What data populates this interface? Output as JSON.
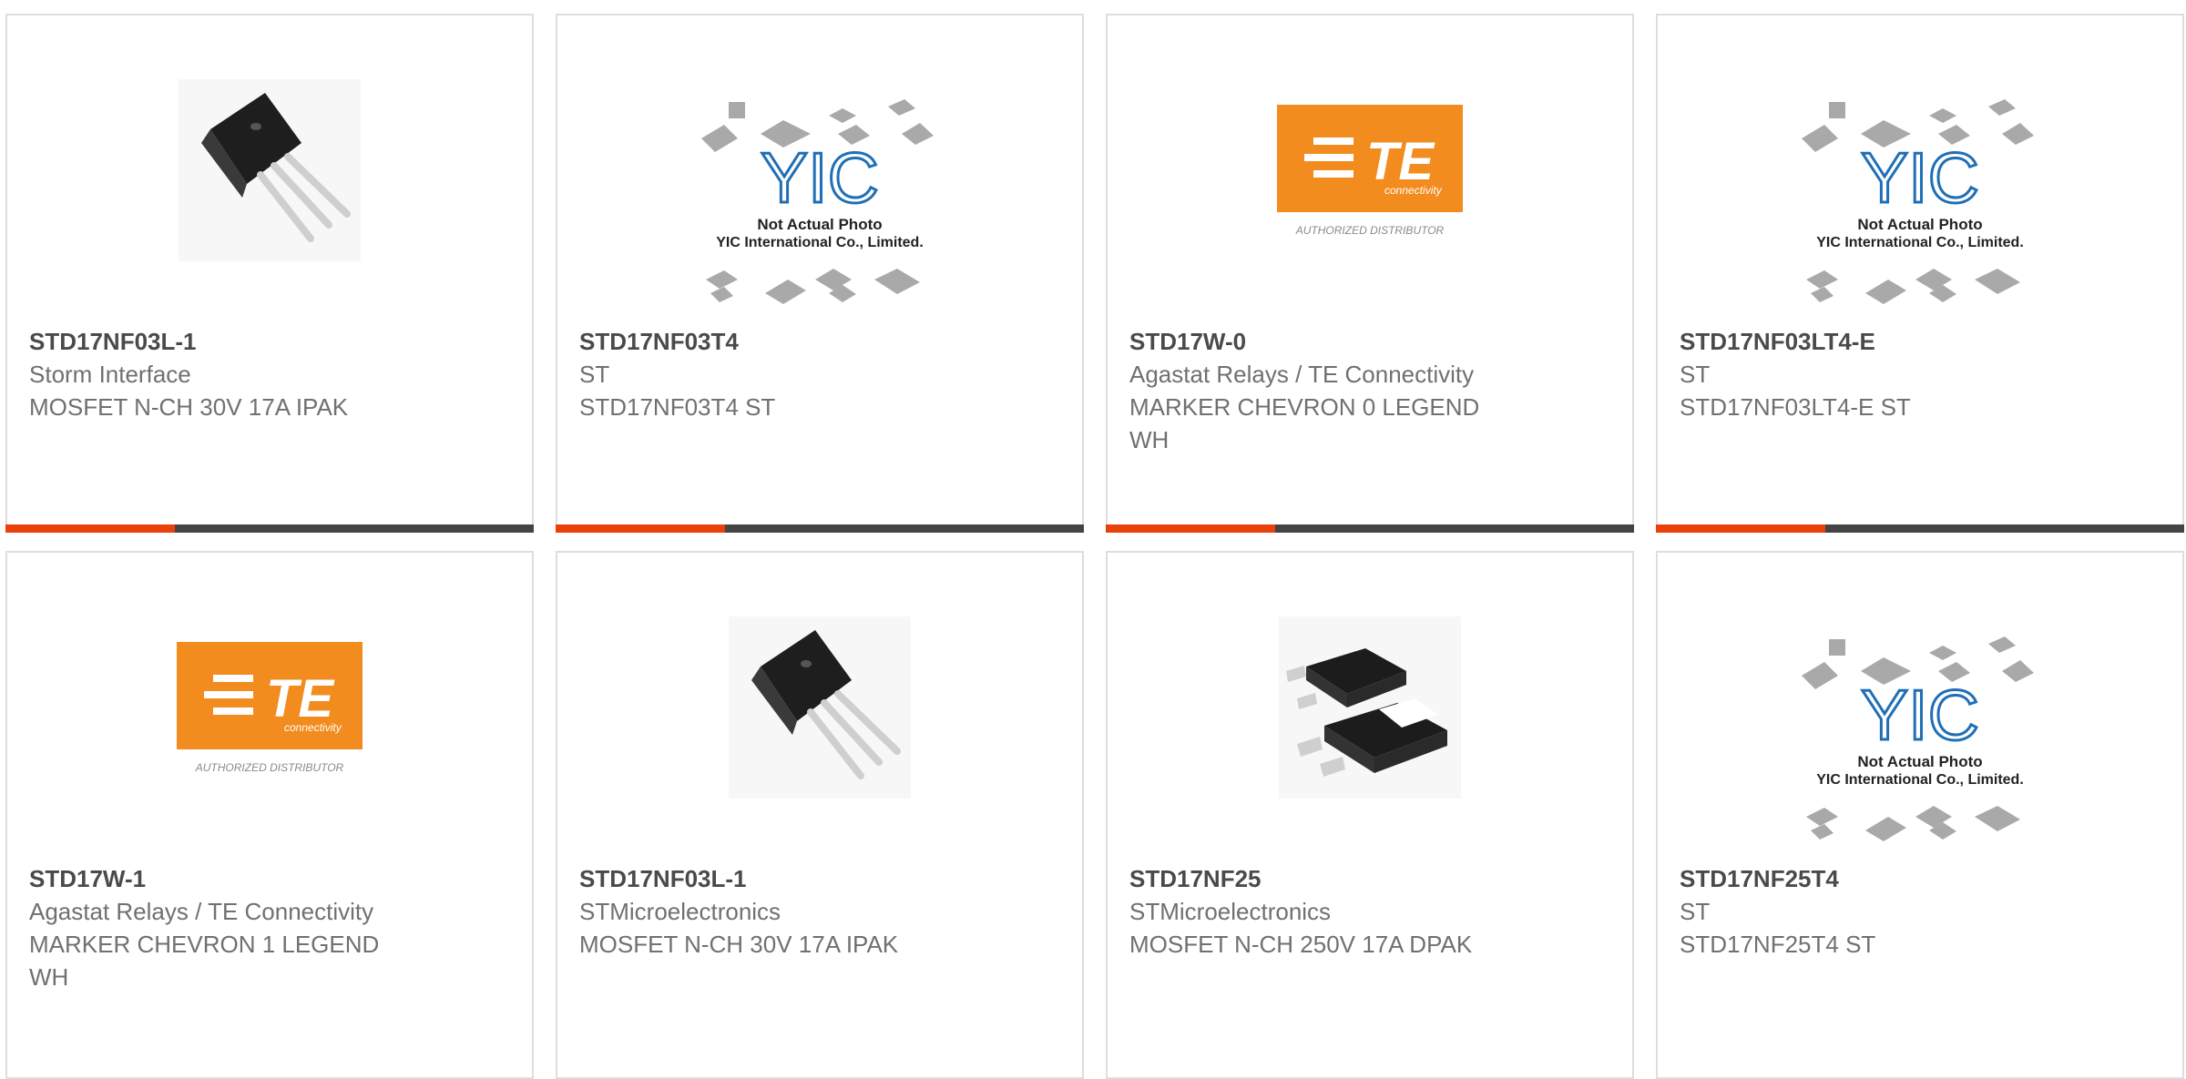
{
  "cards": [
    {
      "part": "STD17NF03L-1",
      "manufacturer": "Storm Interface",
      "description": "MOSFET N-CH 30V 17A IPAK",
      "image": "ipak-transistor"
    },
    {
      "part": "STD17NF03T4",
      "manufacturer": "ST",
      "description": "STD17NF03T4 ST",
      "image": "yic-placeholder"
    },
    {
      "part": "STD17W-0",
      "manufacturer": "Agastat Relays / TE Connectivity",
      "description": "MARKER CHEVRON 0 LEGEND WH",
      "image": "te-logo"
    },
    {
      "part": "STD17NF03LT4-E",
      "manufacturer": "ST",
      "description": "STD17NF03LT4-E ST",
      "image": "yic-placeholder"
    },
    {
      "part": "STD17W-1",
      "manufacturer": "Agastat Relays / TE Connectivity",
      "description": "MARKER CHEVRON 1 LEGEND WH",
      "image": "te-logo"
    },
    {
      "part": "STD17NF03L-1",
      "manufacturer": "STMicroelectronics",
      "description": "MOSFET N-CH 30V 17A IPAK",
      "image": "ipak-transistor"
    },
    {
      "part": "STD17NF25",
      "manufacturer": "STMicroelectronics",
      "description": "MOSFET N-CH 250V 17A DPAK",
      "image": "dpak-transistor"
    },
    {
      "part": "STD17NF25T4",
      "manufacturer": "ST",
      "description": "STD17NF25T4 ST",
      "image": "yic-placeholder"
    }
  ],
  "images": {
    "yic": {
      "logo": "YIC",
      "line1": "Not Actual Photo",
      "line2": "YIC International Co., Limited."
    },
    "te": {
      "logo": "TE",
      "tagline": "connectivity",
      "footer": "AUTHORIZED DISTRIBUTOR"
    }
  },
  "colors": {
    "accent": "#e8410b",
    "bar": "#444444",
    "te_orange": "#f28c1e",
    "yic_blue": "#1f6fb6"
  }
}
